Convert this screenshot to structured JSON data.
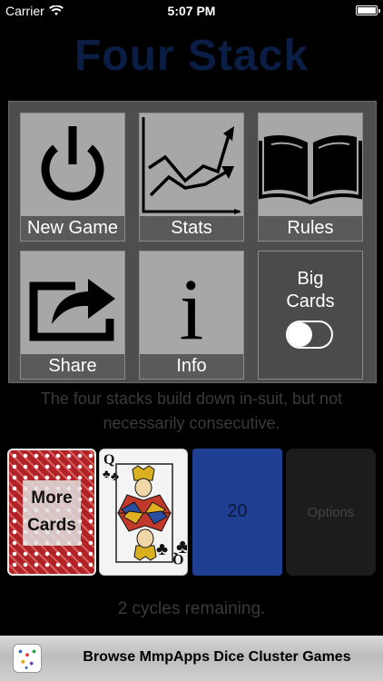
{
  "status_bar": {
    "carrier": "Carrier",
    "time": "5:07 PM"
  },
  "app": {
    "title": "Four Stack"
  },
  "menu": {
    "tiles": [
      {
        "label": "New Game",
        "icon": "power-icon"
      },
      {
        "label": "Stats",
        "icon": "stats-chart-icon"
      },
      {
        "label": "Rules",
        "icon": "open-book-icon"
      },
      {
        "label": "Share",
        "icon": "share-arrow-icon"
      },
      {
        "label": "Info",
        "icon": "info-icon"
      }
    ],
    "big_cards": {
      "label_line1": "Big",
      "label_line2": "Cards",
      "enabled": false
    }
  },
  "hint": {
    "line1": "The four stacks build down in-suit, but not",
    "line2": "necessarily consecutive."
  },
  "table": {
    "more_cards": {
      "line1": "More",
      "line2": "Cards"
    },
    "current_card": "Queen of Clubs",
    "stack_count": "20",
    "options_label": "Options"
  },
  "cycles_text": "2 cycles remaining.",
  "ad": {
    "text": "Browse MmpApps Dice Cluster Games"
  },
  "colors": {
    "title": "#0a1e45",
    "stack": "#1f3f93",
    "card_back": "#b02225",
    "overlay": "#4e4e4e",
    "tile": "#a7a7a7"
  }
}
